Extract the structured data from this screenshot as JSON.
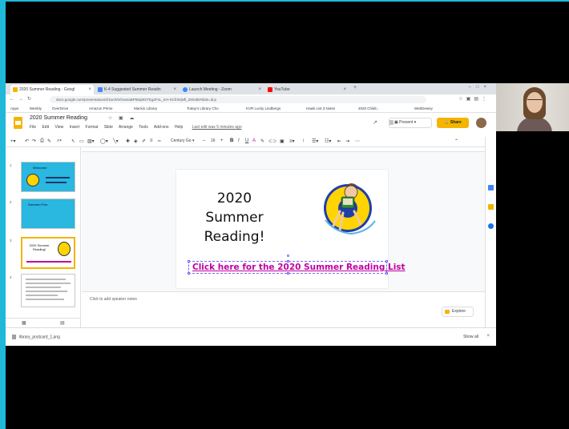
{
  "browser": {
    "tabs": [
      {
        "title": "2020 Summer Reading - Googl",
        "active": true
      },
      {
        "title": "K-4 Suggested Summer Readin",
        "active": false
      },
      {
        "title": "Launch Meeting - Zoom",
        "active": false
      },
      {
        "title": "YouTube",
        "active": false
      }
    ],
    "url": "docs.google.com/presentation/d/1tuVkhrhoesaBPtt8q9tXTEg2FsL_KH-SCfr00jNfl_Z8/edit#slide=id.p",
    "bookmarks": [
      "Apps",
      "Weebly",
      "OverDrive",
      "Amazon Prime",
      "Mackin Library",
      "Today's Library Cho",
      "KVR Lucky Lindbergs",
      "Hawk List 3 Notes",
      "2020 Childr...",
      "WebDewey"
    ]
  },
  "slides": {
    "doc_title": "2020 Summer Reading",
    "menus": [
      "File",
      "Edit",
      "View",
      "Insert",
      "Format",
      "Slide",
      "Arrange",
      "Tools",
      "Add-ons",
      "Help"
    ],
    "last_edit": "Last edit was 5 minutes ago",
    "present_label": "Present",
    "share_label": "Share",
    "toolbar": {
      "font": "Century Go",
      "font_size": "16"
    }
  },
  "filmstrip": {
    "thumbs": [
      {
        "num": "1",
        "text": "Welcome"
      },
      {
        "num": "2",
        "text": "Summer Fun"
      },
      {
        "num": "3",
        "text": "2020 Summer Reading!"
      },
      {
        "num": "4",
        "text": ""
      }
    ]
  },
  "slide": {
    "title_lines": [
      "2020",
      "Summer",
      "Reading!"
    ],
    "link_text": "Click here for the 2020 Summer Reading List"
  },
  "notes": {
    "placeholder": "Click to add speaker notes",
    "explore_label": "Explore"
  },
  "downloads": {
    "file": "library_postcard_1.png",
    "show_all": "Show all"
  },
  "colors": {
    "accent_cyan": "#1fb8d8",
    "share_yellow": "#f4b400",
    "link_magenta": "#c000a0",
    "selection_purple": "#7b61ff"
  }
}
